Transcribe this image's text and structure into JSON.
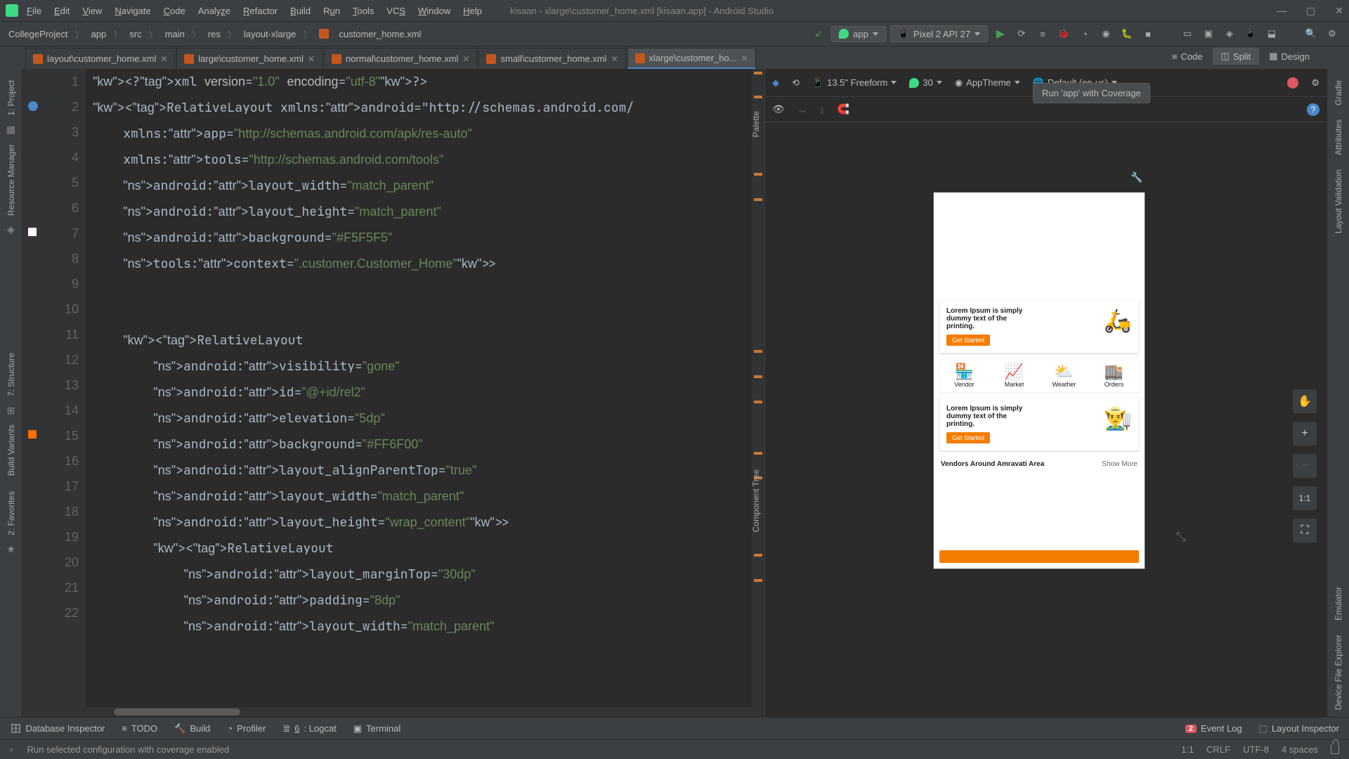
{
  "window": {
    "title": "kisaan - xlarge\\customer_home.xml [kisaan.app] - Android Studio"
  },
  "menu": [
    "File",
    "Edit",
    "View",
    "Navigate",
    "Code",
    "Analyze",
    "Refactor",
    "Build",
    "Run",
    "Tools",
    "VCS",
    "Window",
    "Help"
  ],
  "breadcrumb": [
    "CollegeProject",
    "app",
    "src",
    "main",
    "res",
    "layout-xlarge",
    "customer_home.xml"
  ],
  "run_config": {
    "app": "app",
    "device": "Pixel 2 API 27"
  },
  "tabs": [
    {
      "label": "layout\\customer_home.xml",
      "active": false
    },
    {
      "label": "large\\customer_home.xml",
      "active": false
    },
    {
      "label": "normal\\customer_home.xml",
      "active": false
    },
    {
      "label": "small\\customer_home.xml",
      "active": false
    },
    {
      "label": "xlarge\\customer_ho...",
      "active": true
    }
  ],
  "tooltip": "Run 'app' with Coverage",
  "view_modes": {
    "code": "Code",
    "split": "Split",
    "design": "Design",
    "active": "Split"
  },
  "left_rail": [
    "1: Project",
    "Resource Manager",
    "7: Structure",
    "Build Variants",
    "2: Favorites"
  ],
  "right_rail": [
    "Gradle",
    "Attributes",
    "Layout Validation",
    "Emulator",
    "Device File Explorer"
  ],
  "design_toolbar": {
    "device": "13.5\" Freeform",
    "api": "30",
    "theme": "AppTheme",
    "locale": "Default (en-us)"
  },
  "palette_label": "Palette",
  "component_tree_label": "Component Tree",
  "preview": {
    "lorem": "Lorem Ipsum is simply dummy text of the printing.",
    "get_started": "Get Started",
    "icons": [
      "Vendor",
      "Market",
      "Weather",
      "Orders"
    ],
    "section": "Vendors Around Amravati Area",
    "show_more": "Show More"
  },
  "zoom_label": "1:1",
  "bottom_tools": [
    "Database Inspector",
    "TODO",
    "Build",
    "Profiler",
    "6: Logcat",
    "Terminal"
  ],
  "bottom_right": {
    "event_count": "2",
    "event_log": "Event Log",
    "layout_inspector": "Layout Inspector"
  },
  "status": {
    "msg": "Run selected configuration with coverage enabled",
    "pos": "1:1",
    "eol": "CRLF",
    "enc": "UTF-8",
    "indent": "4 spaces"
  },
  "code_lines": [
    "<?xml version=\"1.0\" encoding=\"utf-8\"?>",
    "<RelativeLayout xmlns:android=\"http://schemas.android.com/",
    "    xmlns:app=\"http://schemas.android.com/apk/res-auto\"",
    "    xmlns:tools=\"http://schemas.android.com/tools\"",
    "    android:layout_width=\"match_parent\"",
    "    android:layout_height=\"match_parent\"",
    "    android:background=\"#F5F5F5\"",
    "    tools:context=\".customer.Customer_Home\">",
    "",
    "",
    "    <RelativeLayout",
    "        android:visibility=\"gone\"",
    "        android:id=\"@+id/rel2\"",
    "        android:elevation=\"5dp\"",
    "        android:background=\"#FF6F00\"",
    "        android:layout_alignParentTop=\"true\"",
    "        android:layout_width=\"match_parent\"",
    "        android:layout_height=\"wrap_content\">",
    "        <RelativeLayout",
    "            android:layout_marginTop=\"30dp\"",
    "            android:padding=\"8dp\"",
    "            android:layout_width=\"match_parent\""
  ]
}
